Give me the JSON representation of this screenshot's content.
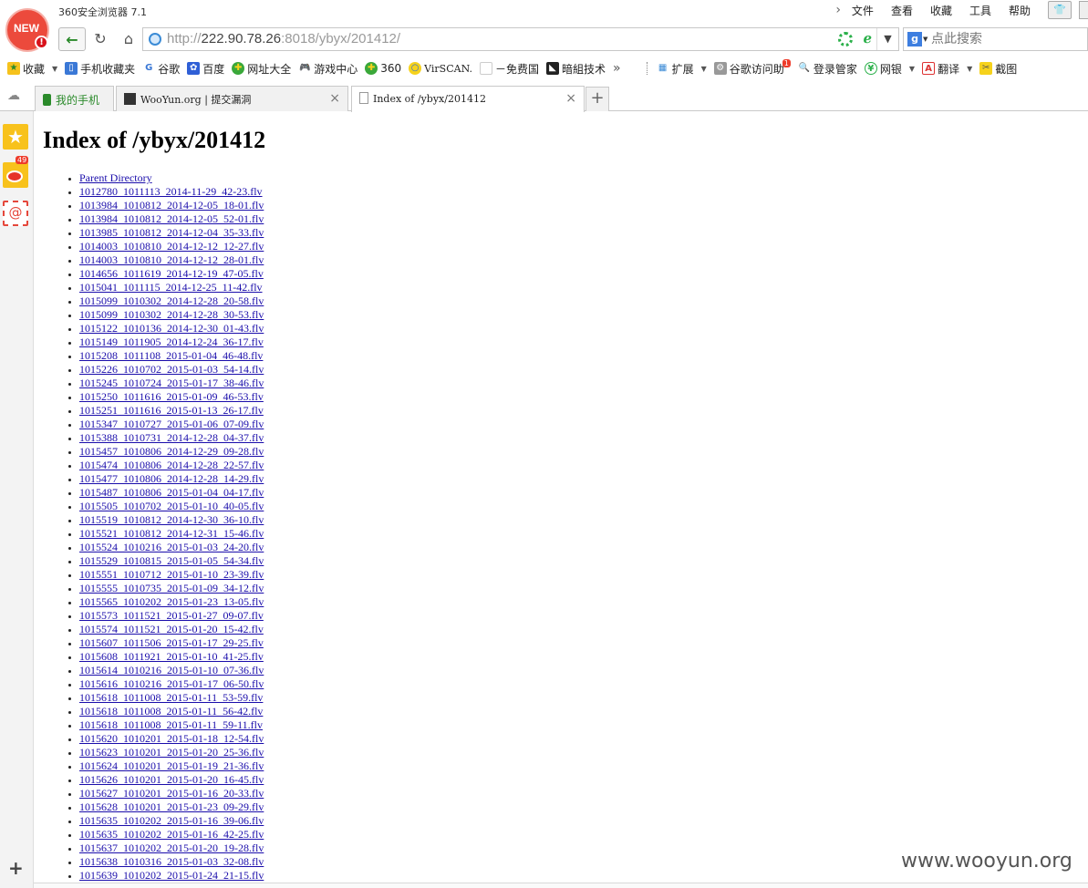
{
  "window": {
    "app_title": "360安全浏览器 7.1",
    "logo_text": "NEW",
    "menu": [
      "文件",
      "查看",
      "收藏",
      "工具",
      "帮助"
    ],
    "pin_icon": "shirt-icon"
  },
  "address_bar": {
    "url_scheme": "http://",
    "url_host": "222.90.78.26",
    "url_rest": ":8018/ybyx/201412/",
    "search_placeholder": "点此搜索",
    "search_engine": "g",
    "colors": {
      "secure": "#2bb04a",
      "back": "#2a8a2a"
    }
  },
  "bookmarks": [
    {
      "label": "收藏",
      "icon": "star-add-icon",
      "dropdown": true
    },
    {
      "label": "手机收藏夹",
      "icon": "phone-icon"
    },
    {
      "label": "谷歌",
      "icon": "google-icon"
    },
    {
      "label": "百度",
      "icon": "baidu-paw-icon"
    },
    {
      "label": "网址大全",
      "icon": "360-icon"
    },
    {
      "label": "游戏中心",
      "icon": "gamepad-icon"
    },
    {
      "label": "360",
      "icon": "360-icon"
    },
    {
      "label": "VirSCAN.",
      "icon": "magnifier-icon"
    },
    {
      "label": "－免费国",
      "icon": "doc-icon"
    },
    {
      "label": "暗組技术",
      "icon": "dark-icon"
    }
  ],
  "bookmarks_more": "»",
  "extensions": [
    {
      "label": "扩展",
      "icon": "grid-icon",
      "dropdown": true
    },
    {
      "label": "谷歌访问助",
      "icon": "gear-icon",
      "badge": "1"
    },
    {
      "label": "登录管家",
      "icon": "key-icon"
    },
    {
      "label": "网银",
      "icon": "yuan-icon",
      "dropdown": true
    },
    {
      "label": "翻译",
      "icon": "translate-icon",
      "dropdown": true
    },
    {
      "label": "截图",
      "icon": "scissors-icon"
    }
  ],
  "tabs": [
    {
      "label": "我的手机",
      "active": false
    },
    {
      "label": "WooYun.org | 提交漏洞",
      "active": false
    },
    {
      "label": "Index of /ybyx/201412",
      "active": true
    }
  ],
  "sidebar": {
    "weibo_count": "49"
  },
  "page": {
    "heading": "Index of /ybyx/201412",
    "parent_link": "Parent Directory",
    "files": [
      "1012780_1011113_2014-11-29_42-23.flv",
      "1013984_1010812_2014-12-05_18-01.flv",
      "1013984_1010812_2014-12-05_52-01.flv",
      "1013985_1010812_2014-12-04_35-33.flv",
      "1014003_1010810_2014-12-12_12-27.flv",
      "1014003_1010810_2014-12-12_28-01.flv",
      "1014656_1011619_2014-12-19_47-05.flv",
      "1015041_1011115_2014-12-25_11-42.flv",
      "1015099_1010302_2014-12-28_20-58.flv",
      "1015099_1010302_2014-12-28_30-53.flv",
      "1015122_1010136_2014-12-30_01-43.flv",
      "1015149_1011905_2014-12-24_36-17.flv",
      "1015208_1011108_2015-01-04_46-48.flv",
      "1015226_1010702_2015-01-03_54-14.flv",
      "1015245_1010724_2015-01-17_38-46.flv",
      "1015250_1011616_2015-01-09_46-53.flv",
      "1015251_1011616_2015-01-13_26-17.flv",
      "1015347_1010727_2015-01-06_07-09.flv",
      "1015388_1010731_2014-12-28_04-37.flv",
      "1015457_1010806_2014-12-29_09-28.flv",
      "1015474_1010806_2014-12-28_22-57.flv",
      "1015477_1010806_2014-12-28_14-29.flv",
      "1015487_1010806_2015-01-04_04-17.flv",
      "1015505_1010702_2015-01-10_40-05.flv",
      "1015519_1010812_2014-12-30_36-10.flv",
      "1015521_1010812_2014-12-31_15-46.flv",
      "1015524_1010216_2015-01-03_24-20.flv",
      "1015529_1010815_2015-01-05_54-34.flv",
      "1015551_1010712_2015-01-10_23-39.flv",
      "1015555_1010735_2015-01-09_34-12.flv",
      "1015565_1010202_2015-01-23_13-05.flv",
      "1015573_1011521_2015-01-27_09-07.flv",
      "1015574_1011521_2015-01-20_15-42.flv",
      "1015607_1011506_2015-01-17_29-25.flv",
      "1015608_1011921_2015-01-10_41-25.flv",
      "1015614_1010216_2015-01-10_07-36.flv",
      "1015616_1010216_2015-01-17_06-50.flv",
      "1015618_1011008_2015-01-11_53-59.flv",
      "1015618_1011008_2015-01-11_56-42.flv",
      "1015618_1011008_2015-01-11_59-11.flv",
      "1015620_1010201_2015-01-18_12-54.flv",
      "1015623_1010201_2015-01-20_25-36.flv",
      "1015624_1010201_2015-01-19_21-36.flv",
      "1015626_1010201_2015-01-20_16-45.flv",
      "1015627_1010201_2015-01-16_20-33.flv",
      "1015628_1010201_2015-01-23_09-29.flv",
      "1015635_1010202_2015-01-16_39-06.flv",
      "1015635_1010202_2015-01-16_42-25.flv",
      "1015637_1010202_2015-01-20_19-28.flv",
      "1015638_1010316_2015-01-03_32-08.flv",
      "1015639_1010202_2015-01-24_21-15.flv"
    ]
  },
  "watermark": "www.wooyun.org"
}
